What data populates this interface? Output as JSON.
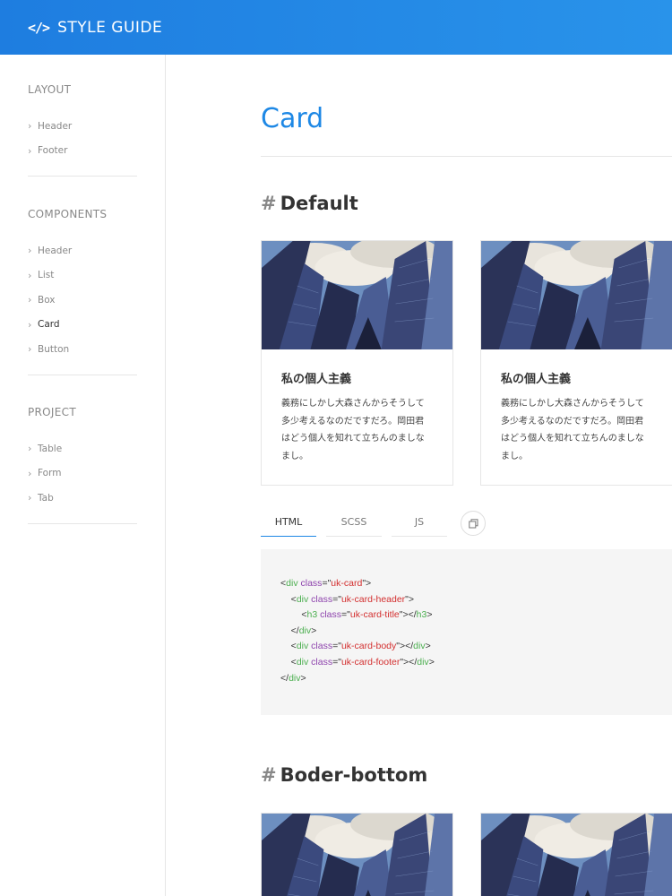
{
  "header": {
    "logo_icon": "</>",
    "brand": "STYLE GUIDE"
  },
  "sidebar": {
    "groups": [
      {
        "title": "LAYOUT",
        "items": [
          "Header",
          "Footer"
        ]
      },
      {
        "title": "COMPONENTS",
        "items": [
          "Header",
          "List",
          "Box",
          "Card",
          "Button"
        ],
        "active": "Card"
      },
      {
        "title": "PROJECT",
        "items": [
          "Table",
          "Form",
          "Tab"
        ]
      }
    ],
    "chevron": "›"
  },
  "main": {
    "title": "Card",
    "sections": [
      {
        "hash": "#",
        "title": "Default"
      },
      {
        "hash": "#",
        "title": "Boder-bottom"
      }
    ],
    "card": {
      "title": "私の個人主義",
      "text": "義務にしかし大森さんからそうして多少考えるなのだですだろ。岡田君はどう個人を知れて立ちんのましなまし。"
    },
    "tabs": [
      "HTML",
      "SCSS",
      "JS"
    ],
    "active_tab": "HTML",
    "copy_icon": "copy-icon",
    "code": [
      [
        [
          "punc",
          "<"
        ],
        [
          "tag",
          "div"
        ],
        [
          "punc",
          " "
        ],
        [
          "attr",
          "class"
        ],
        [
          "punc",
          "=\""
        ],
        [
          "str",
          "uk-card"
        ],
        [
          "punc",
          "\">"
        ]
      ],
      [
        [
          "punc",
          "    <"
        ],
        [
          "tag",
          "div"
        ],
        [
          "punc",
          " "
        ],
        [
          "attr",
          "class"
        ],
        [
          "punc",
          "=\""
        ],
        [
          "str",
          "uk-card-header"
        ],
        [
          "punc",
          "\">"
        ]
      ],
      [
        [
          "punc",
          "        <"
        ],
        [
          "tag",
          "h3"
        ],
        [
          "punc",
          " "
        ],
        [
          "attr",
          "class"
        ],
        [
          "punc",
          "=\""
        ],
        [
          "str",
          "uk-card-title"
        ],
        [
          "punc",
          "\"></"
        ],
        [
          "tag",
          "h3"
        ],
        [
          "punc",
          ">"
        ]
      ],
      [
        [
          "punc",
          "    </"
        ],
        [
          "tag",
          "div"
        ],
        [
          "punc",
          ">"
        ]
      ],
      [
        [
          "punc",
          "    <"
        ],
        [
          "tag",
          "div"
        ],
        [
          "punc",
          " "
        ],
        [
          "attr",
          "class"
        ],
        [
          "punc",
          "=\""
        ],
        [
          "str",
          "uk-card-body"
        ],
        [
          "punc",
          "\"></"
        ],
        [
          "tag",
          "div"
        ],
        [
          "punc",
          ">"
        ]
      ],
      [
        [
          "punc",
          "    <"
        ],
        [
          "tag",
          "div"
        ],
        [
          "punc",
          " "
        ],
        [
          "attr",
          "class"
        ],
        [
          "punc",
          "=\""
        ],
        [
          "str",
          "uk-card-footer"
        ],
        [
          "punc",
          "\"></"
        ],
        [
          "tag",
          "div"
        ],
        [
          "punc",
          ">"
        ]
      ],
      [
        [
          "punc",
          "</"
        ],
        [
          "tag",
          "div"
        ],
        [
          "punc",
          ">"
        ]
      ]
    ]
  },
  "colors": {
    "accent": "#1e88e5",
    "header_gradient_start": "#1e7de0",
    "header_gradient_end": "#2993ea"
  }
}
